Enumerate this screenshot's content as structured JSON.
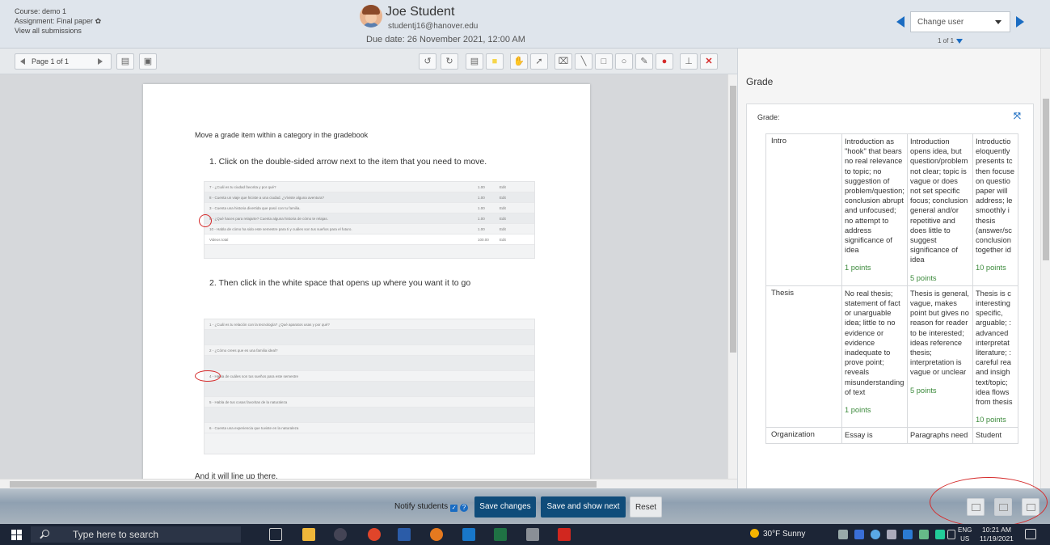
{
  "header": {
    "course": "Course: demo 1",
    "assignment": "Assignment: Final paper",
    "view_all": "View all submissions",
    "user_name": "Joe Student",
    "user_email": "studentj16@hanover.edu",
    "due_date": "Due date: 26 November 2021, 12:00 AM",
    "change_user": "Change user",
    "user_count": "1 of 1"
  },
  "toolbar": {
    "page_label": "Page 1 of 1"
  },
  "document": {
    "title": "Move a grade item within a category in the gradebook",
    "step1": "1.  Click on the double-sided arrow next to the item that you need to move.",
    "step2": "2.  Then click in the white space that opens up where you want it to go",
    "tail": "And it will line up there.",
    "img1_rows": [
      "7 - ¿Cuál es tu ciudad favorita y por qué?",
      "8 - Cuenta un viaje que hiciste a una ciudad. ¿Viviste alguna aventura?",
      "3 - Cuenta una historia divertida que pasó con tu familia.",
      "9 - ¿Qué haces para relajarte? Cuenta alguna historia de cómo te relajas.",
      "10 - Habla de cómo ha sido este semestre para ti y cuáles son tus sueños para el futuro.",
      "Videos total"
    ],
    "img1_vals": [
      "1.00",
      "1.00",
      "1.00",
      "1.00",
      "1.00",
      "100.00"
    ],
    "img1_edit": "Edit",
    "img2_rows": [
      "1 - ¿Cuál es tu relación con la tecnología? ¿Qué aparatos usas y por qué?",
      "",
      "2 - ¿Cómo crees que es una familia ideal?",
      "",
      "4 - Habla de cuáles son tus sueños para este semestre",
      "",
      "5 - Habla de tus cosas favoritas de la naturaleza",
      "",
      "6 - Cuenta una experiencia que tuviste en la naturaleza"
    ]
  },
  "grade": {
    "heading": "Grade",
    "label": "Grade:",
    "criteria": [
      {
        "name": "Intro",
        "levels": [
          {
            "text": "Introduction as \"hook\" that bears no real relevance to topic; no suggestion of problem/question; conclusion abrupt and unfocused; no attempt to address significance of idea",
            "points": "1 points"
          },
          {
            "text": "Introduction opens idea, but question/problem not clear; topic is vague or does not set specific focus; conclusion general and/or repetitive and does little to suggest significance of idea",
            "points": "5 points"
          },
          {
            "text": "Introductio eloquently presents tc then focuse on questio paper will address; le smoothly i thesis (answer/sc conclusion together id",
            "points": "10 points"
          }
        ]
      },
      {
        "name": "Thesis",
        "levels": [
          {
            "text": "No real thesis; statement of fact or unarguable idea; little to no evidence or evidence inadequate to prove point; reveals misunderstanding of text",
            "points": "1 points"
          },
          {
            "text": "Thesis is general, vague, makes point but gives no reason for reader to be interested; ideas reference thesis; interpretation is vague or unclear",
            "points": "5 points"
          },
          {
            "text": "Thesis is c interesting specific, arguable; : advanced interpretat literature; : careful rea and insigh text/topic; idea flows from thesis",
            "points": "10 points"
          }
        ]
      },
      {
        "name": "Organization",
        "levels": [
          {
            "text": "Essay is",
            "points": ""
          },
          {
            "text": "Paragraphs need",
            "points": ""
          },
          {
            "text": "Student",
            "points": ""
          }
        ]
      }
    ]
  },
  "footer": {
    "notify_label": "Notify students",
    "save": "Save changes",
    "save_next": "Save and show next",
    "reset": "Reset"
  },
  "taskbar": {
    "search_placeholder": "Type here to search",
    "weather": "30°F  Sunny",
    "lang_top": "ENG",
    "lang_bottom": "US",
    "time": "10:21 AM",
    "date": "11/19/2021"
  },
  "colors": {
    "primary": "#0f4c7a",
    "accent": "#1a6cc2",
    "annotation": "#d52b2b",
    "points": "#3c8a3c"
  }
}
